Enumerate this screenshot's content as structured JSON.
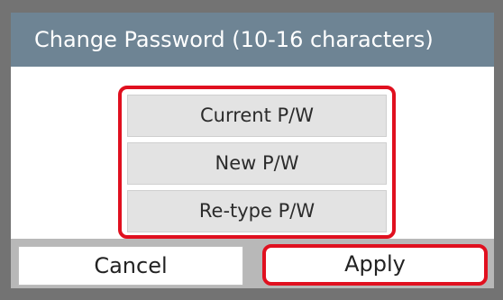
{
  "dialog": {
    "title": "Change Password (10-16 characters)"
  },
  "fields": [
    {
      "label": "Current P/W"
    },
    {
      "label": "New P/W"
    },
    {
      "label": "Re-type P/W"
    }
  ],
  "buttons": {
    "cancel_label": "Cancel",
    "apply_label": "Apply"
  },
  "colors": {
    "title_bar": "#6e8494",
    "highlight": "#e0101f",
    "field_bg": "#e3e3e3",
    "bottom_bar": "#b8b8b8"
  }
}
